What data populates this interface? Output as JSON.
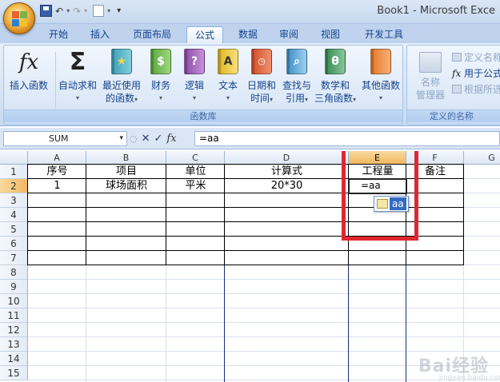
{
  "window": {
    "title": "Book1 - Microsoft Exce"
  },
  "quick_access": {
    "undo": "↶",
    "redo": "↷",
    "more": "▾"
  },
  "tabs": [
    "开始",
    "插入",
    "页面布局",
    "公式",
    "数据",
    "审阅",
    "视图",
    "开发工具"
  ],
  "active_tab": "公式",
  "ribbon": {
    "function_library": {
      "label": "函数库",
      "insert_function": "插入函数",
      "autosum": [
        "自动求和"
      ],
      "recent": [
        "最近使用",
        "的函数"
      ],
      "financial": [
        "财务"
      ],
      "logical": [
        "逻辑"
      ],
      "text": [
        "文本"
      ],
      "datetime": [
        "日期和",
        "时间"
      ],
      "lookup": [
        "查找与",
        "引用"
      ],
      "math": [
        "数学和",
        "三角函数"
      ],
      "more": [
        "其他函数"
      ]
    },
    "defined_names": {
      "label": "定义的名称",
      "name_manager": [
        "名称",
        "管理器"
      ],
      "define_name": "定义名称",
      "use_in_formula": "用于公式",
      "create_from_selection": "根据所选"
    }
  },
  "formula_bar": {
    "name_box": "SUM",
    "formula": "=aa"
  },
  "sheet": {
    "columns": [
      "A",
      "B",
      "C",
      "D",
      "E",
      "F",
      "G"
    ],
    "selected_column": "E",
    "rows": [
      "1",
      "2",
      "3",
      "4",
      "5",
      "6",
      "7",
      "8",
      "9",
      "10",
      "11",
      "12",
      "13",
      "14",
      "15"
    ],
    "selected_row": "2",
    "header_row": [
      "序号",
      "项目",
      "单位",
      "计算式",
      "工程量",
      "备注"
    ],
    "data_row": [
      "1",
      "球场面积",
      "平米",
      "20*30",
      "",
      ""
    ],
    "editing_value": "=aa",
    "autocomplete_item": "aa"
  },
  "watermark": {
    "brand": "Bai经验",
    "url": "jingyan.baidu.com"
  },
  "colors": {
    "highlight_box": "#e0262f",
    "selection_header": "#f1b862",
    "autocomplete_select": "#316ac5"
  }
}
